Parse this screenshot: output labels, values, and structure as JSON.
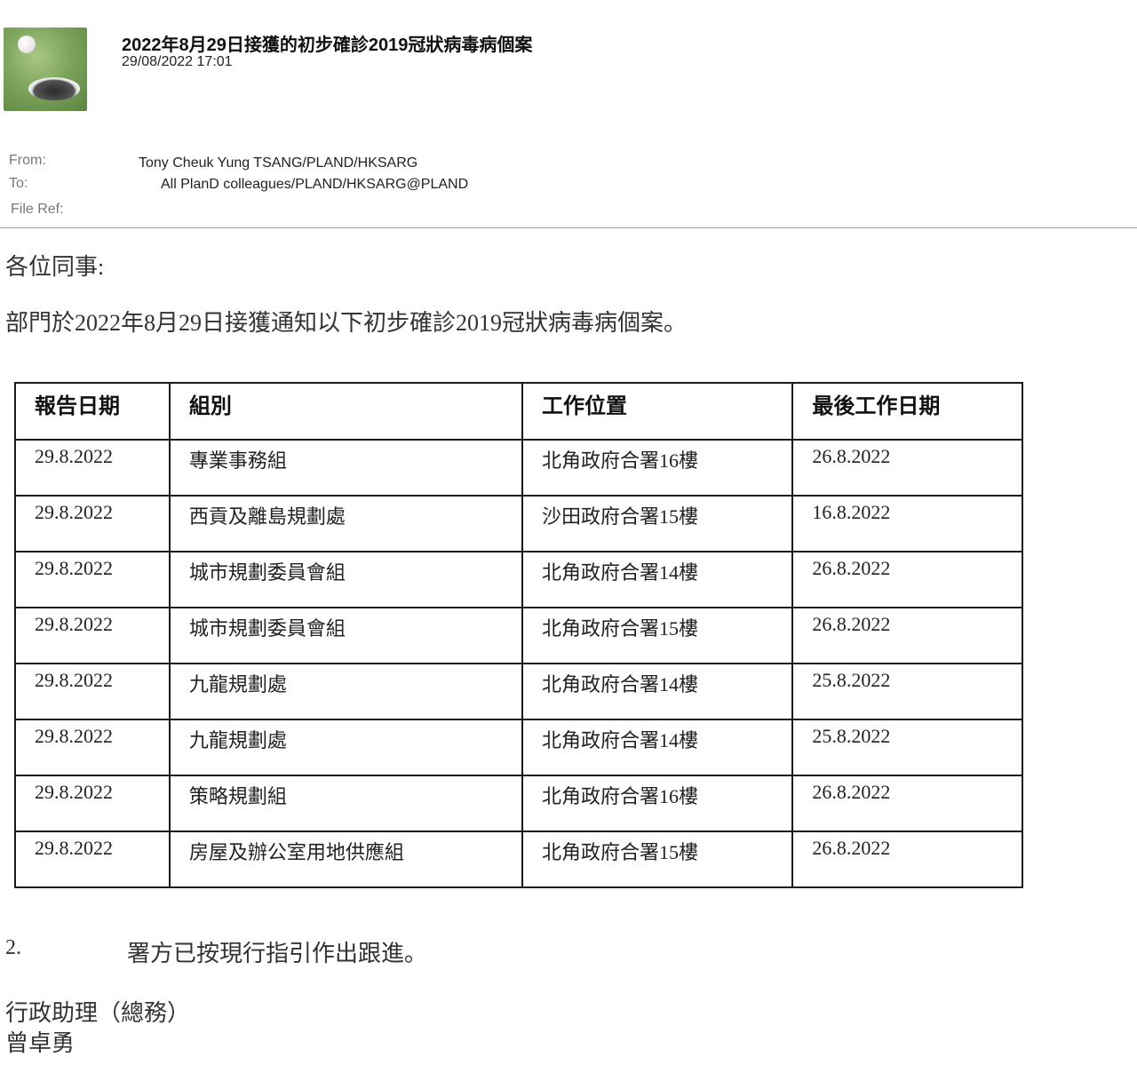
{
  "email": {
    "subject": "2022年8月29日接獲的初步確診2019冠狀病毒病個案",
    "date": "29/08/2022 17:01",
    "from_label": "From:",
    "from_value": "Tony Cheuk Yung TSANG/PLAND/HKSARG",
    "to_label": "To:",
    "to_value": "All PlanD colleagues/PLAND/HKSARG@PLAND",
    "fileref_label": "File Ref:"
  },
  "body": {
    "greeting": "各位同事:",
    "intro": "部門於2022年8月29日接獲通知以下初步確診2019冠狀病毒病個案。",
    "para2_num": "2.",
    "para2_text": "署方已按現行指引作出跟進。",
    "sig_title": "行政助理（總務）",
    "sig_name": "曾卓勇"
  },
  "table": {
    "headers": [
      "報告日期",
      "組別",
      "工作位置",
      "最後工作日期"
    ],
    "rows": [
      [
        "29.8.2022",
        "專業事務組",
        "北角政府合署16樓",
        "26.8.2022"
      ],
      [
        "29.8.2022",
        "西貢及離島規劃處",
        "沙田政府合署15樓",
        "16.8.2022"
      ],
      [
        "29.8.2022",
        "城市規劃委員會組",
        "北角政府合署14樓",
        "26.8.2022"
      ],
      [
        "29.8.2022",
        "城市規劃委員會組",
        "北角政府合署15樓",
        "26.8.2022"
      ],
      [
        "29.8.2022",
        "九龍規劃處",
        "北角政府合署14樓",
        "25.8.2022"
      ],
      [
        "29.8.2022",
        "九龍規劃處",
        "北角政府合署14樓",
        "25.8.2022"
      ],
      [
        "29.8.2022",
        "策略規劃組",
        "北角政府合署16樓",
        "26.8.2022"
      ],
      [
        "29.8.2022",
        "房屋及辦公室用地供應組",
        "北角政府合署15樓",
        "26.8.2022"
      ]
    ]
  }
}
